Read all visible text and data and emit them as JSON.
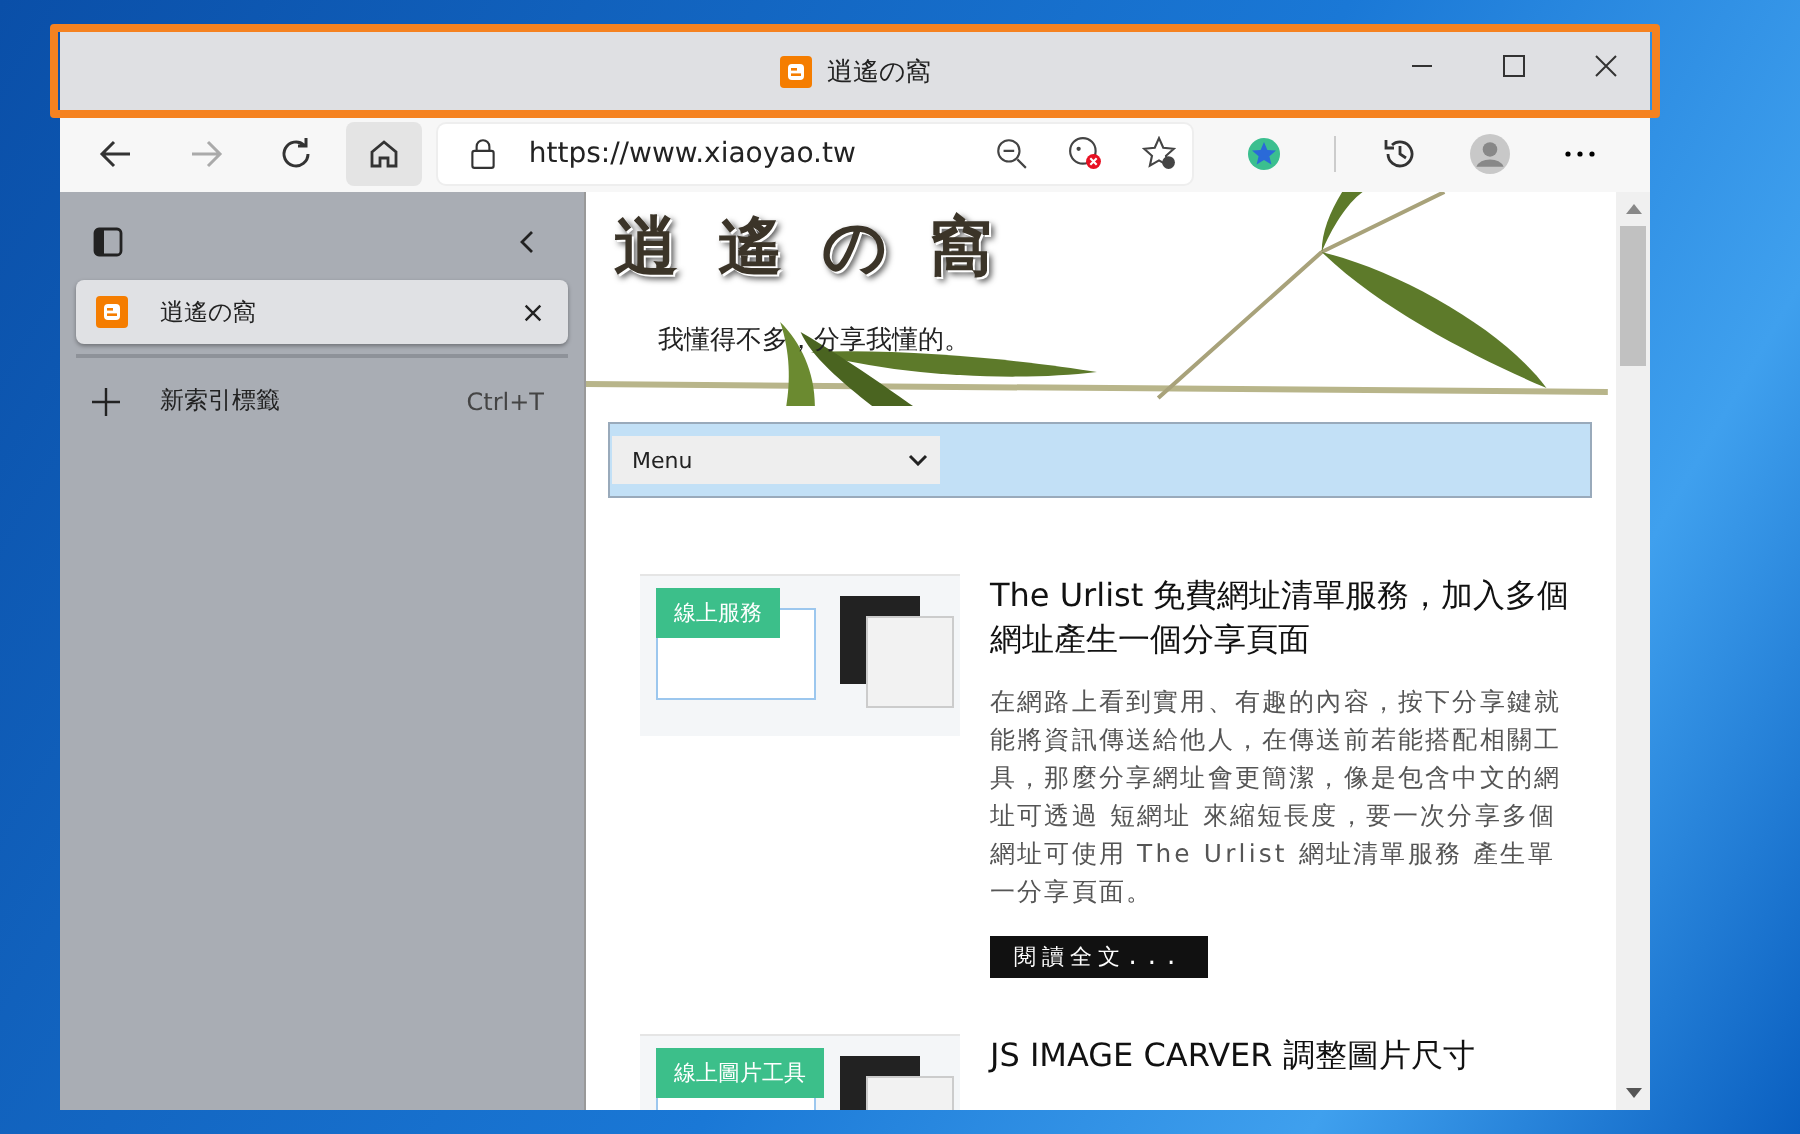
{
  "window": {
    "title": "逍遙の窩"
  },
  "toolbar": {
    "url": "https://www.xiaoyao.tw"
  },
  "sidebar": {
    "tabs": [
      {
        "title": "逍遙の窩",
        "selected": true
      }
    ],
    "new_tab": {
      "label": "新索引標籤",
      "shortcut": "Ctrl+T"
    }
  },
  "page": {
    "banner": {
      "title": "逍遙の窩",
      "tagline": "我懂得不多，分享我懂的。"
    },
    "menu": {
      "label": "Menu"
    },
    "posts": [
      {
        "badge": "線上服務",
        "title": "The Urlist 免費網址清單服務，加入多個網址產生一個分享頁面",
        "summary": "在網路上看到實用、有趣的內容，按下分享鍵就能將資訊傳送給他人，在傳送前若能搭配相關工具，那麼分享網址會更簡潔，像是包含中文的網址可透過 短網址 來縮短長度，要一次分享多個網址可使用 The Urlist 網址清單服務 產生單一分享頁面。",
        "read_more": "閱讀全文..."
      },
      {
        "badge": "線上圖片工具",
        "title": "JS IMAGE CARVER 調整圖片尺寸"
      }
    ]
  }
}
